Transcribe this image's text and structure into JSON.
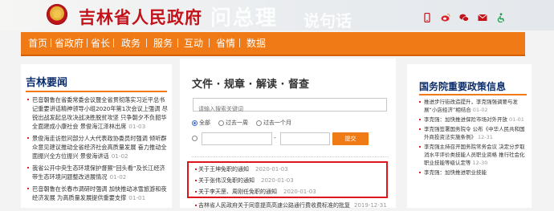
{
  "header": {
    "site_title": "吉林省人民政府",
    "watermark_large": "问总理",
    "watermark_small": "说句话",
    "icons": [
      "mobile-icon",
      "weibo-icon",
      "wechat-icon",
      "mail-icon",
      "accessibility-icon"
    ]
  },
  "nav": {
    "items": [
      "首页",
      "省政府",
      "省长",
      "政务",
      "服务",
      "互动",
      "省情",
      "数据"
    ]
  },
  "left": {
    "title": "吉林要闻",
    "news": [
      {
        "text": "巴音朝鲁在省委常委会议暨全省贯彻落实习近平总书记重要讲话精神领导小组2020年第1次会议上强调 尽锐出战发起总攻决战决胜脱贫攻坚 只争朝夕不负韶华全面建成小康社会 景俊海江泽林出席",
        "date": "01-03"
      },
      {
        "text": "景俊海走访慰问部分人大代表政协委员时强调 倾听群众意见建议推动全省经济社会高质量发展 奋力推动全面振兴全方位振兴 景俊海讲话",
        "date": "01-02"
      },
      {
        "text": "我省公开中央生态环境保护督察“回头看”及长江经济带生态环境问题整改进展情况",
        "date": "01-02"
      },
      {
        "text": "巴音朝鲁在长春市调研时强调 加快推动冰雪旅游和夜经济发展 为高质量发展提供重要支撑",
        "date": "01-01"
      }
    ]
  },
  "middle": {
    "title": "文件 · 规章 · 解读 · 督查",
    "search_placeholder": "请输入搜索关键词",
    "radio_all": "全部",
    "radio_week": "过去一周",
    "radio_month": "过去一个月",
    "submit_label": "提交",
    "notices": [
      {
        "text": "关于王坤免职的通知",
        "date": "2020-01-03"
      },
      {
        "text": "关于张伟汉免职的通知",
        "date": "2020-01-03"
      },
      {
        "text": "关于李天罡、周刚任免职的通知",
        "date": "2020-01-03"
      }
    ],
    "last_item": {
      "text": "吉林省人民政府关于同意提高高速公路通行费收费标准的批复",
      "date": "2019-12-31"
    }
  },
  "right": {
    "title": "国务院重要政策信息",
    "items": [
      {
        "text": "推进步行街改造提升，李克强强调要与发展“小店经济”相结合",
        "date": "01-02"
      },
      {
        "text": "李克强：加快推进保险市场对外开放",
        "date": "01-01"
      },
      {
        "text": "李克强签署国务院令 公布《中华人民共和国外商投资法实施条例》",
        "date": "12-31"
      },
      {
        "text": "李克强主持召开国务院常务会议 决定分步取消水平评价类技能人员职业资格 推行社会化职业技能等级认定等",
        "date": "12-30"
      },
      {
        "text": "李克强：加快推进职业技能",
        "date": ""
      }
    ]
  },
  "colors": {
    "nav": "#f07b16",
    "title_red": "#c4121a",
    "heading_blue": "#0b2d6b",
    "highlight_red": "#e0151a"
  }
}
